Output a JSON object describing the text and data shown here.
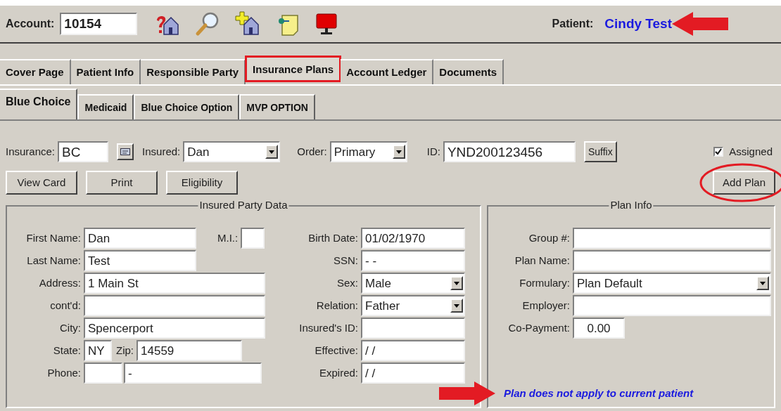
{
  "account": {
    "label": "Account:",
    "value": "10154"
  },
  "patient": {
    "label": "Patient:",
    "name": "Cindy Test",
    "arrow": true
  },
  "tabs": [
    {
      "label": "Cover Page",
      "selected": false,
      "highlighted": false
    },
    {
      "label": "Patient Info",
      "selected": false,
      "highlighted": false
    },
    {
      "label": "Responsible Party",
      "selected": false,
      "highlighted": false
    },
    {
      "label": "Insurance Plans",
      "selected": true,
      "highlighted": true
    },
    {
      "label": "Account Ledger",
      "selected": false,
      "highlighted": false
    },
    {
      "label": "Documents",
      "selected": false,
      "highlighted": false
    }
  ],
  "plan_tabs": [
    {
      "label": "Blue Choice",
      "selected": true
    },
    {
      "label": "Medicaid",
      "selected": false
    },
    {
      "label": "Blue Choice Option",
      "selected": false
    },
    {
      "label": "MVP OPTION",
      "selected": false
    }
  ],
  "insurance_row": {
    "insurance": {
      "label": "Insurance:",
      "value": "BC"
    },
    "insured": {
      "label": "Insured:",
      "value": "Dan"
    },
    "order": {
      "label": "Order:",
      "value": "Primary"
    },
    "id": {
      "label": "ID:",
      "value": "YND200123456"
    },
    "suffix_button": "Suffix",
    "assigned": {
      "label": "Assigned",
      "checked": true
    }
  },
  "buttons": [
    "View Card",
    "Print",
    "Eligibility"
  ],
  "add_plan": {
    "label": "Add Plan",
    "circled": true
  },
  "insured_party": {
    "title": "Insured Party Data",
    "left_rows": [
      [
        {
          "label": "First Name:",
          "value": "Dan",
          "kind": "text"
        },
        {
          "label": "M.I.:",
          "kind": "text"
        }
      ],
      [
        {
          "label": "Last Name:",
          "value": "Test",
          "kind": "text"
        }
      ],
      [
        {
          "label": "Address:",
          "value": "1 Main St",
          "kind": "text"
        }
      ],
      [
        {
          "label": "cont'd:",
          "kind": "text"
        }
      ],
      [
        {
          "label": "City:",
          "value": "Spencerport",
          "kind": "text"
        }
      ],
      [
        {
          "label": "State:",
          "value": "NY",
          "kind": "text"
        },
        {
          "label": "Zip:",
          "value": "14559",
          "kind": "text"
        }
      ],
      [
        {
          "label": "Phone:",
          "value": "-",
          "kind": "phone"
        }
      ]
    ],
    "right_rows": [
      {
        "label": "Birth Date:",
        "value": "01/02/1970",
        "kind": "text"
      },
      {
        "label": "SSN:",
        "value": "- -",
        "kind": "text"
      },
      {
        "label": "Sex:",
        "value": "Male",
        "kind": "dropdown"
      },
      {
        "label": "Relation:",
        "value": "Father",
        "kind": "dropdown"
      },
      {
        "label": "Insured's ID:",
        "kind": "text"
      },
      {
        "label": "Effective:",
        "value": "/ /",
        "kind": "text"
      },
      {
        "label": "Expired:",
        "value": "/ /",
        "kind": "text"
      }
    ]
  },
  "plan_info": {
    "title": "Plan Info",
    "fields": [
      {
        "label": "Group #:",
        "kind": "text"
      },
      {
        "label": "Plan Name:",
        "kind": "text"
      },
      {
        "label": "Formulary:",
        "value": "Plan Default",
        "kind": "dropdown"
      },
      {
        "label": "Employer:",
        "kind": "text"
      },
      {
        "label": "Co-Payment:",
        "value": "0.00",
        "kind": "short"
      }
    ],
    "notice": "Plan does not apply to current patient",
    "notice_arrow": true
  }
}
